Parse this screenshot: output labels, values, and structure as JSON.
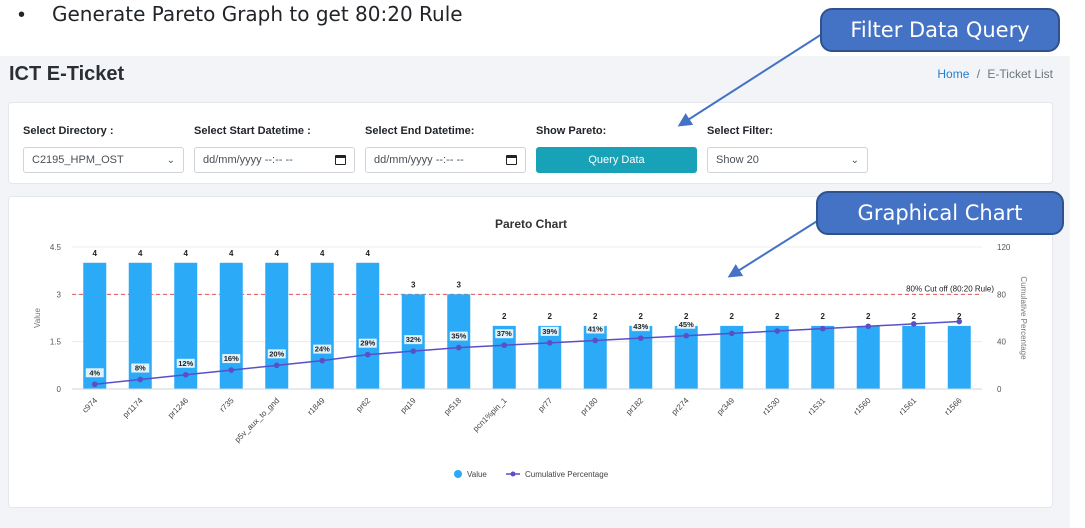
{
  "bullet": {
    "symbol": "•",
    "text": "Generate Pareto Graph to get 80:20 Rule"
  },
  "header": {
    "title": "ICT E-Ticket",
    "breadcrumb_home": "Home",
    "breadcrumb_sep": "/",
    "breadcrumb_current": "E-Ticket List"
  },
  "filters": {
    "directory_label": "Select Directory :",
    "directory_value": "C2195_HPM_OST",
    "start_label": "Select Start Datetime :",
    "start_value": "dd/mm/yyyy --:-- --",
    "end_label": "Select End Datetime:",
    "end_value": "dd/mm/yyyy --:-- --",
    "pareto_label": "Show Pareto:",
    "query_button": "Query Data",
    "filter_label": "Select Filter:",
    "filter_value": "Show 20"
  },
  "callouts": {
    "filter": "Filter Data Query",
    "chart": "Graphical Chart"
  },
  "colors": {
    "bar": "#2baaf7",
    "line": "#5b4fc7",
    "cutoff": "#e05a5a",
    "button": "#17a2b8",
    "callout": "#4472c4"
  },
  "chart_data": {
    "type": "bar",
    "title": "Pareto Chart",
    "ylabel": "Value",
    "y2label": "Cumulative Percentage",
    "ylim": [
      0,
      4.5
    ],
    "y2lim": [
      0,
      120
    ],
    "yticks": [
      "0",
      "1.5",
      "3",
      "4.5"
    ],
    "y2ticks": [
      "0",
      "40",
      "80",
      "120"
    ],
    "categories": [
      "c974",
      "pr1174",
      "pr1246",
      "r735",
      "p5v_aux_to_gnd",
      "r1849",
      "pr62",
      "pq19",
      "pr518",
      "pcn1%pin_1",
      "pr77",
      "pr180",
      "pr182",
      "pr274",
      "pr349",
      "r1530",
      "r1531",
      "r1560",
      "r1561",
      "r1566"
    ],
    "series": [
      {
        "name": "Value",
        "type": "bar",
        "values": [
          4,
          4,
          4,
          4,
          4,
          4,
          4,
          3,
          3,
          2,
          2,
          2,
          2,
          2,
          2,
          2,
          2,
          2,
          2,
          2
        ],
        "labels": [
          "4",
          "4",
          "4",
          "4",
          "4",
          "4",
          "4",
          "3",
          "3",
          "2",
          "2",
          "2",
          "2",
          "2",
          "2",
          "2",
          "2",
          "2",
          "2",
          "2"
        ]
      },
      {
        "name": "Cumulative Percentage",
        "type": "line",
        "values": [
          4,
          8,
          12,
          16,
          20,
          24,
          29,
          32,
          35,
          37,
          39,
          41,
          43,
          45,
          47,
          49,
          51,
          53,
          55,
          57
        ],
        "labels": [
          "4%",
          "8%",
          "12%",
          "16%",
          "20%",
          "24%",
          "29%",
          "32%",
          "35%",
          "37%",
          "39%",
          "41%",
          "43%",
          "45%",
          "",
          "",
          "",
          "",
          "",
          ""
        ]
      }
    ],
    "cutoff": {
      "value": 80,
      "label": "80% Cut off (80:20 Rule)"
    },
    "legend": "bottom"
  }
}
